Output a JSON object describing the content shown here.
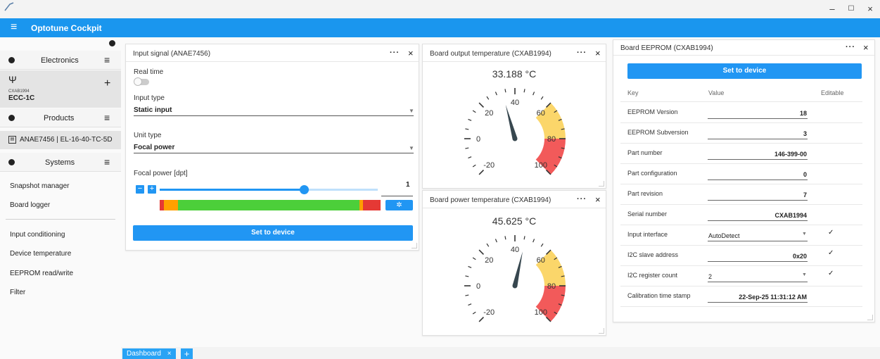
{
  "window": {
    "minimize": "–",
    "maximize": "☐",
    "close": "×"
  },
  "app": {
    "title": "Optotune Cockpit",
    "menu_icon": "≡"
  },
  "sidebar": {
    "electronics_label": "Electronics",
    "device": {
      "serial": "CXAB1994",
      "model": "ECC-1C",
      "add": "+"
    },
    "products_label": "Products",
    "product": {
      "text": "ANAE7456  |  EL-16-40-TC-5D"
    },
    "systems_label": "Systems",
    "menu_icon": "≡",
    "items_top": [
      "Snapshot manager",
      "Board logger"
    ],
    "items_bottom": [
      "Input conditioning",
      "Device temperature",
      "EEPROM read/write",
      "Filter"
    ]
  },
  "input_panel": {
    "title": "Input signal (ANAE7456)",
    "more": "···",
    "close": "×",
    "realtime_label": "Real time",
    "input_type_label": "Input type",
    "input_type_value": "Static input",
    "unit_type_label": "Unit type",
    "unit_type_value": "Focal power",
    "focal_label": "Focal power [dpt]",
    "focal_value": "1",
    "focal_fraction": 0.66,
    "minus": "−",
    "plus": "+",
    "set_button": "Set to device",
    "range_colors": [
      "#e53935",
      "#ffa000",
      "#4ccf3a",
      "#ffa000",
      "#e53935"
    ]
  },
  "out_temp_panel": {
    "title": "Board output temperature (CXAB1994)",
    "more": "···",
    "close": "×",
    "value": "33.188 °C",
    "reading": 33.188,
    "ticks": [
      "-20",
      "0",
      "20",
      "40",
      "60",
      "80",
      "100"
    ]
  },
  "pow_temp_panel": {
    "title": "Board power temperature (CXAB1994)",
    "more": "···",
    "close": "×",
    "value": "45.625 °C",
    "reading": 45.625,
    "ticks": [
      "-20",
      "0",
      "20",
      "40",
      "60",
      "80",
      "100"
    ]
  },
  "gauge_colors": {
    "warn": "#fbd66a",
    "danger": "#f25a5a",
    "needle": "#37474f"
  },
  "eeprom_panel": {
    "title": "Board EEPROM (CXAB1994)",
    "more": "···",
    "close": "×",
    "set_button": "Set to device",
    "headers": {
      "key": "Key",
      "value": "Value",
      "editable": "Editable"
    },
    "rows": [
      {
        "key": "EEPROM Version",
        "value": "18",
        "editable": ""
      },
      {
        "key": "EEPROM Subversion",
        "value": "3",
        "editable": ""
      },
      {
        "key": "Part number",
        "value": "146-399-00",
        "editable": ""
      },
      {
        "key": "Part configuration",
        "value": "0",
        "editable": ""
      },
      {
        "key": "Part revision",
        "value": "7",
        "editable": ""
      },
      {
        "key": "Serial number",
        "value": "CXAB1994",
        "editable": ""
      },
      {
        "key": "Input interface",
        "value": "AutoDetect",
        "editable": "✓"
      },
      {
        "key": "I2C slave address",
        "value": "0x20",
        "editable": "✓"
      },
      {
        "key": "I2C register count",
        "value": "2",
        "editable": "✓"
      },
      {
        "key": "Calibration time stamp",
        "value": "22-Sep-25 11:31:12 AM",
        "editable": ""
      }
    ]
  },
  "tabs": {
    "dashboard": "Dashboard",
    "close": "×",
    "add": "+"
  }
}
